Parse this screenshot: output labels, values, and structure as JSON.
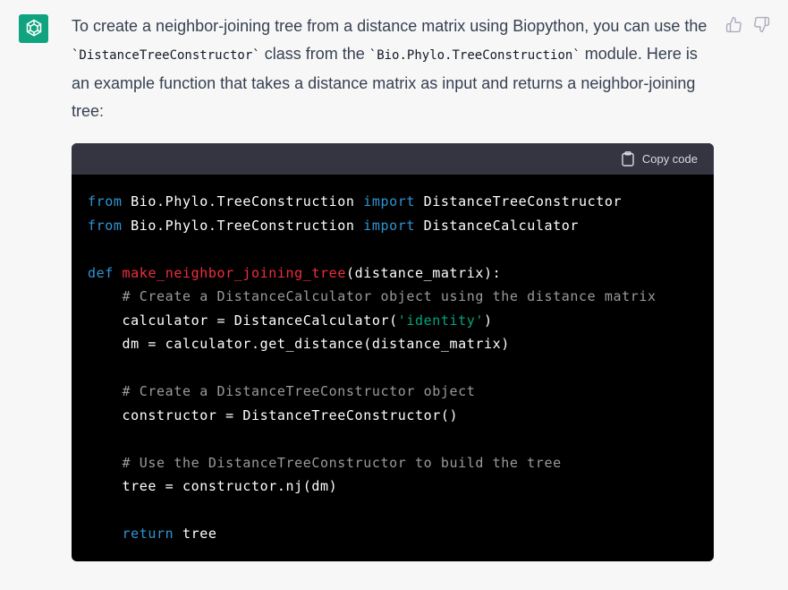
{
  "message": {
    "p1_part1": "To create a neighbor-joining tree from a distance matrix using Biopython, you can use the ",
    "p1_code1": "`DistanceTreeConstructor`",
    "p1_part2": " class from the ",
    "p1_code2": "`Bio.Phylo.TreeConstruction`",
    "p1_part3": " module. Here is an example function that takes a distance matrix as input and returns a neighbor-joining tree:"
  },
  "code_header": {
    "copy_label": "Copy code"
  },
  "code": {
    "l1_kw": "from",
    "l1_a": " Bio.Phylo.TreeConstruction ",
    "l1_kw2": "import",
    "l1_b": " DistanceTreeConstructor",
    "l2_kw": "from",
    "l2_a": " Bio.Phylo.TreeConstruction ",
    "l2_kw2": "import",
    "l2_b": " DistanceCalculator",
    "l4_kw": "def",
    "l4_fn": "make_neighbor_joining_tree",
    "l4_b": "(distance_matrix):",
    "l5_cm": "# Create a DistanceCalculator object using the distance matrix",
    "l6_a": "calculator = DistanceCalculator(",
    "l6_st": "'identity'",
    "l6_b": ")",
    "l7": "dm = calculator.get_distance(distance_matrix)",
    "l9_cm": "# Create a DistanceTreeConstructor object",
    "l10": "constructor = DistanceTreeConstructor()",
    "l12_cm": "# Use the DistanceTreeConstructor to build the tree",
    "l13": "tree = constructor.nj(dm)",
    "l15_kw": "return",
    "l15_b": " tree"
  },
  "colors": {
    "avatar_bg": "#10a37f",
    "keyword": "#2e95d3",
    "function": "#f22c3d",
    "comment": "#9a9a9a",
    "string": "#00a67d"
  }
}
